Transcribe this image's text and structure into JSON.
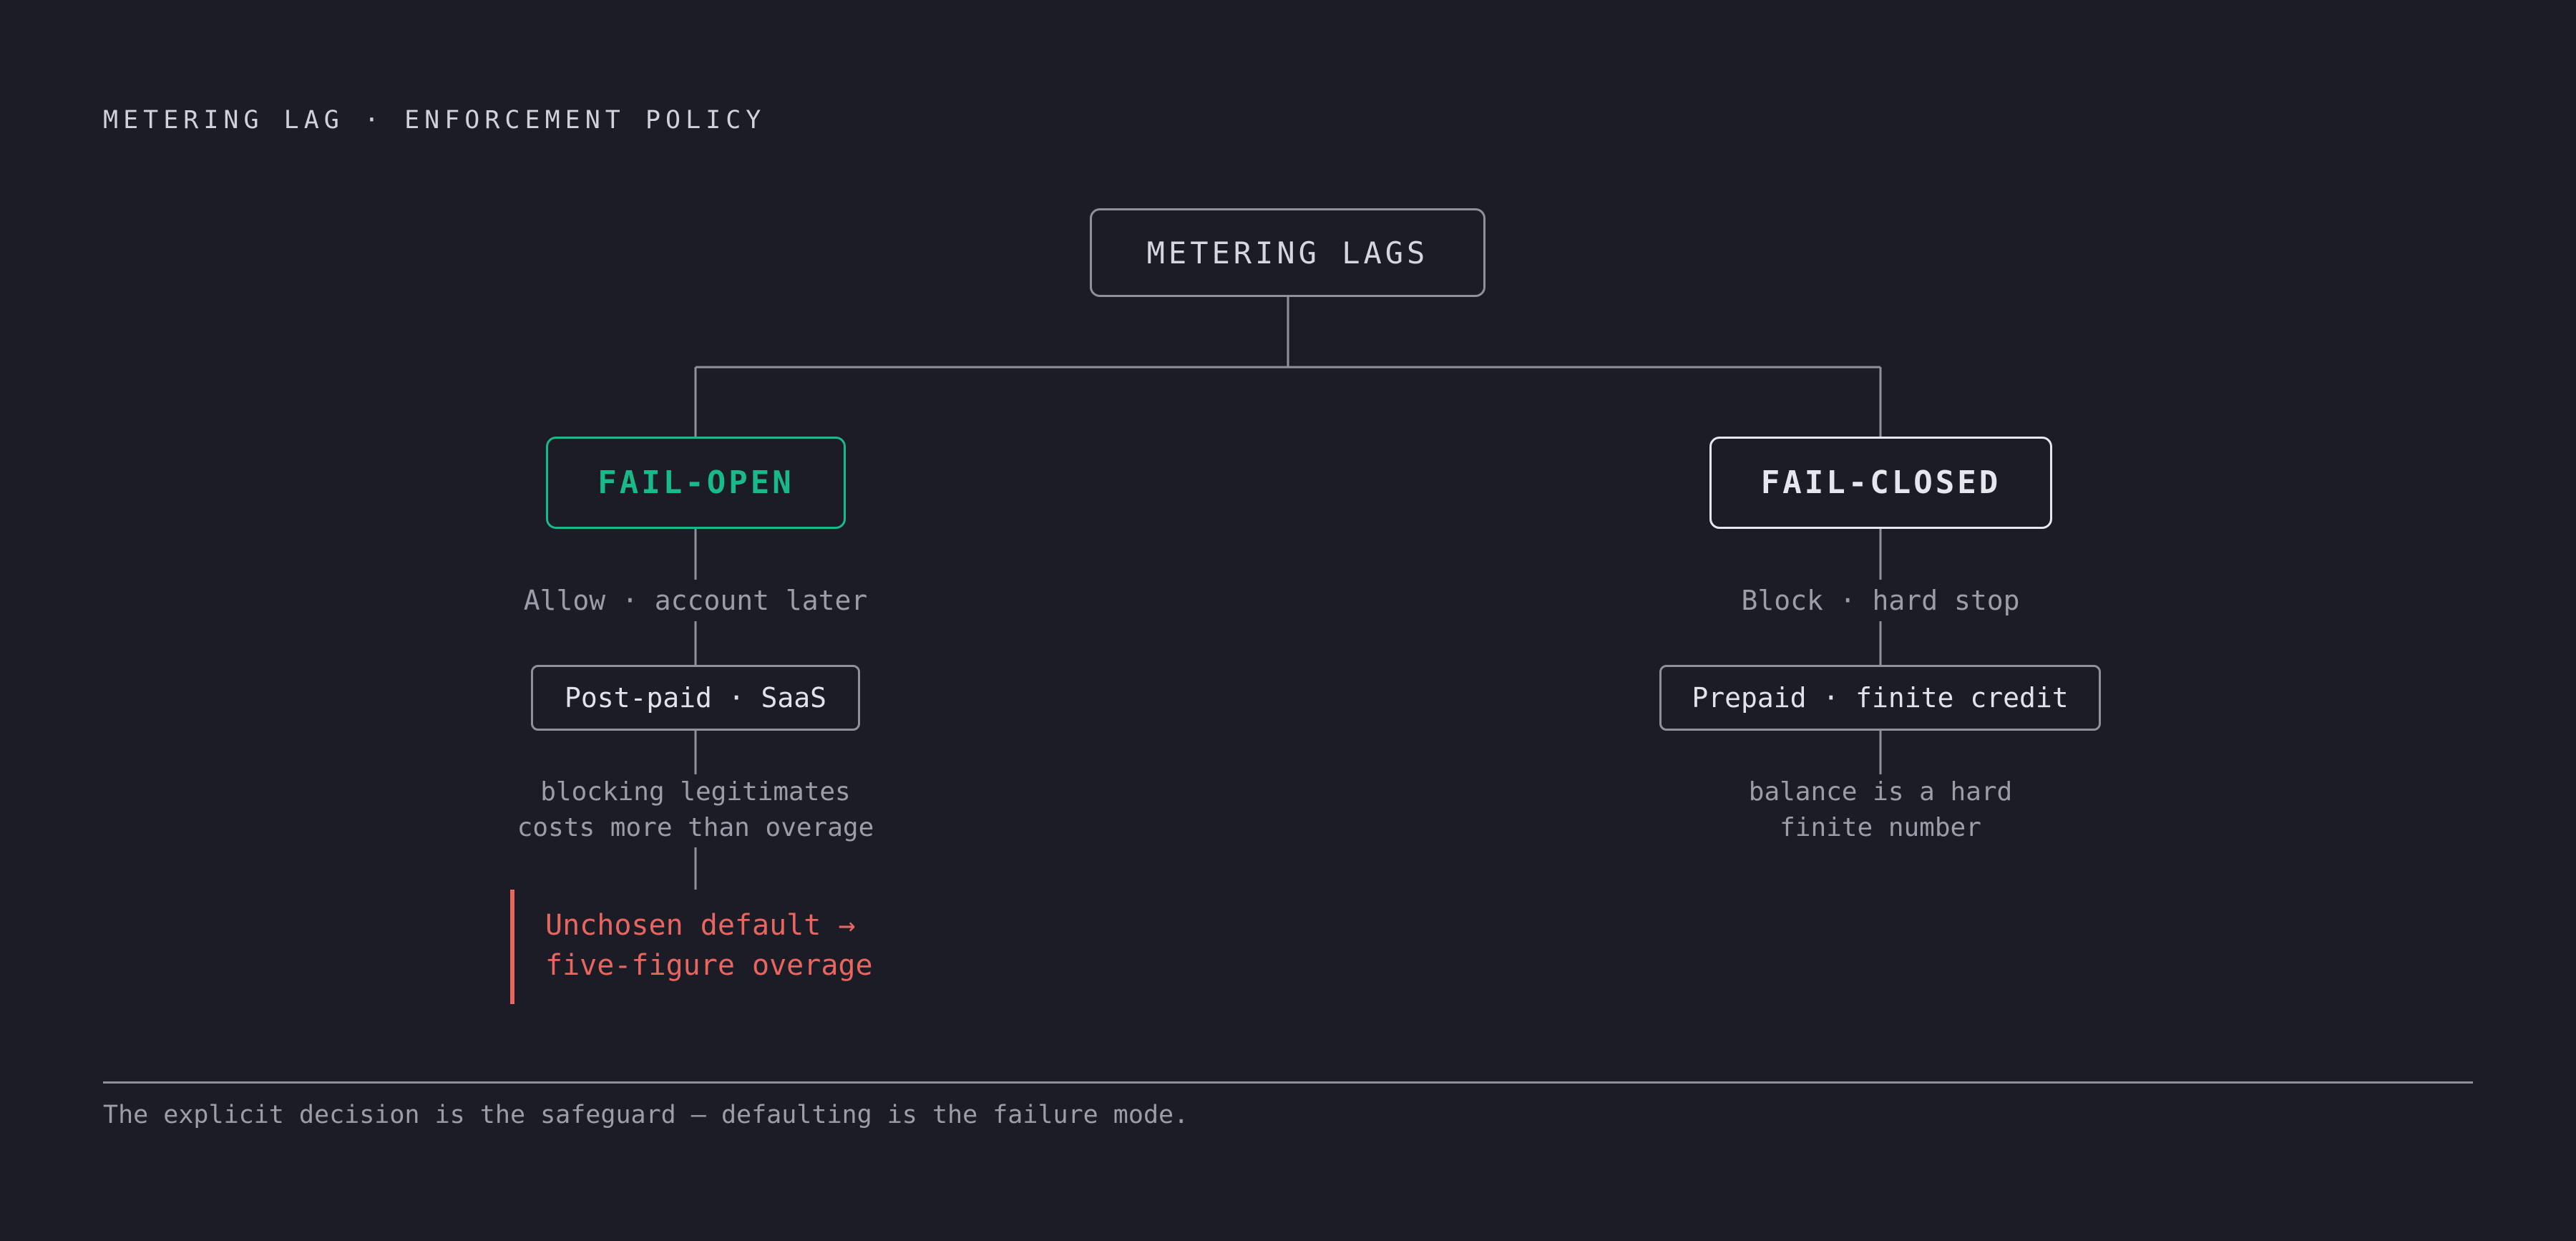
{
  "title": "METERING LAG · ENFORCEMENT POLICY",
  "root": {
    "label": "METERING LAGS"
  },
  "fail_open": {
    "label": "FAIL-OPEN",
    "action": "Allow · account later",
    "use_case": "Post-paid · SaaS",
    "rationale": [
      "blocking legitimates",
      "costs more than overage"
    ],
    "warning": [
      "Unchosen default →",
      "five-figure overage"
    ]
  },
  "fail_closed": {
    "label": "FAIL-CLOSED",
    "action": "Block · hard stop",
    "use_case": "Prepaid · finite credit",
    "rationale": [
      "balance is a hard",
      "finite number"
    ]
  },
  "footer": "The explicit decision is the safeguard — defaulting is the failure mode.",
  "colors": {
    "background": "#1b1c26",
    "fail_open_accent": "#19b98a",
    "warning": "#e9655f",
    "line": "#8e909c"
  }
}
